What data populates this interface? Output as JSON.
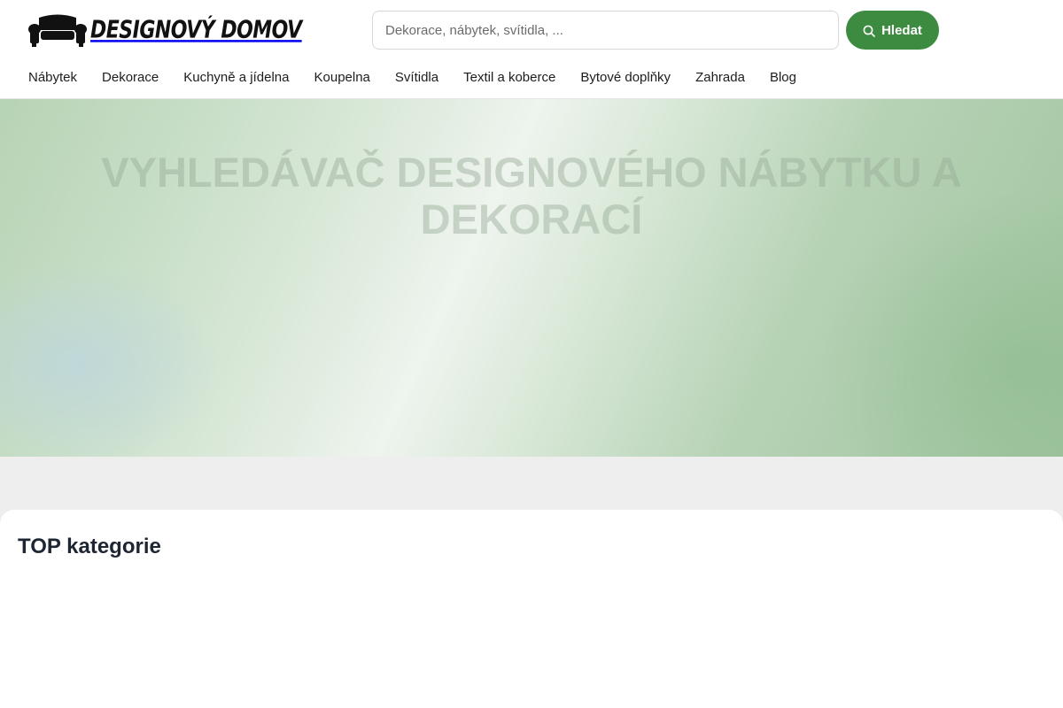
{
  "brand": {
    "name": "DESIGNOVÝ DOMOV",
    "icon": "sofa-icon"
  },
  "search": {
    "placeholder": "Dekorace, nábytek, svítidla, ...",
    "value": "",
    "button_label": "Hledat",
    "button_icon": "search-icon",
    "button_color": "#3d8b40"
  },
  "nav": {
    "items": [
      "Nábytek",
      "Dekorace",
      "Kuchyně a jídelna",
      "Koupelna",
      "Svítidla",
      "Textil a koberce",
      "Bytové doplňky",
      "Zahrada",
      "Blog"
    ]
  },
  "hero": {
    "title": "Vyhledávač designového nábytku a dekorací"
  },
  "top_categories": {
    "heading": "TOP kategorie"
  }
}
